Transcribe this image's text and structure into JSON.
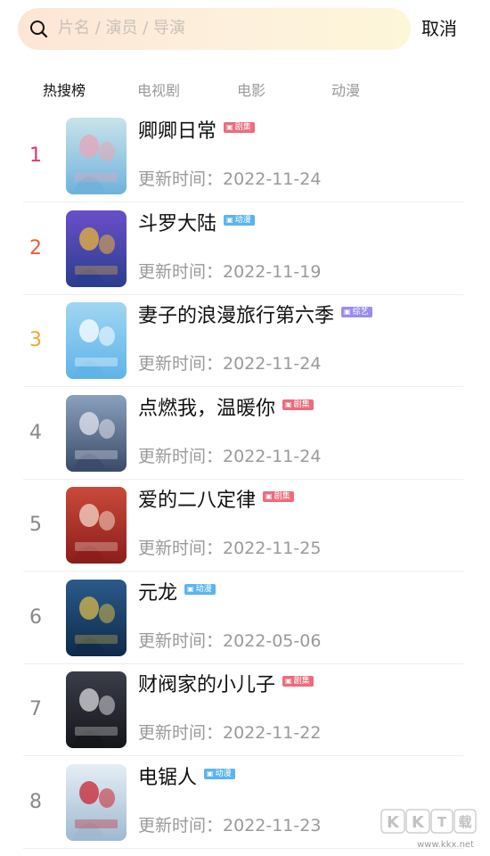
{
  "search": {
    "placeholder": "片名 / 演员 / 导演",
    "icon": "search-icon",
    "cancel_label": "取消"
  },
  "tabs": [
    {
      "label": "热搜榜",
      "active": true
    },
    {
      "label": "电视剧",
      "active": false
    },
    {
      "label": "电影",
      "active": false
    },
    {
      "label": "动漫",
      "active": false
    }
  ],
  "updated_prefix": "更新时间：",
  "badge_colors": {
    "剧集": "#ee6b7b",
    "动漫": "#5bb4ee",
    "综艺": "#9b8df0"
  },
  "rank_colors": {
    "1": "#e8336a",
    "2": "#ef5a3b",
    "3": "#f0a53a",
    "default": "#888888"
  },
  "items": [
    {
      "rank": "1",
      "title": "卿卿日常",
      "badge": "剧集",
      "updated": "更新时间：2022-11-24",
      "poster_colors": [
        "#6fb2dc",
        "#c9e3ea",
        "#e9a5b7"
      ]
    },
    {
      "rank": "2",
      "title": "斗罗大陆",
      "badge": "动漫",
      "updated": "更新时间：2022-11-19",
      "poster_colors": [
        "#2a3d8f",
        "#6a4fc8",
        "#e9b53a"
      ]
    },
    {
      "rank": "3",
      "title": "妻子的浪漫旅行第六季",
      "badge": "综艺",
      "updated": "更新时间：2022-11-24",
      "poster_colors": [
        "#5fb3e8",
        "#9fd6f2",
        "#ffffff"
      ]
    },
    {
      "rank": "4",
      "title": "点燃我，温暖你",
      "badge": "剧集",
      "updated": "更新时间：2022-11-24",
      "poster_colors": [
        "#3a4b6a",
        "#8aa0bd",
        "#e6e6ee"
      ]
    },
    {
      "rank": "5",
      "title": "爱的二八定律",
      "badge": "剧集",
      "updated": "更新时间：2022-11-25",
      "poster_colors": [
        "#8c1d1d",
        "#c94a3a",
        "#f4d8c8"
      ]
    },
    {
      "rank": "6",
      "title": "元龙",
      "badge": "动漫",
      "updated": "更新时间：2022-05-06",
      "poster_colors": [
        "#0f2a4a",
        "#2a5a8a",
        "#d8b84a"
      ]
    },
    {
      "rank": "7",
      "title": "财阀家的小儿子",
      "badge": "剧集",
      "updated": "更新时间：2022-11-22",
      "poster_colors": [
        "#15161c",
        "#3b3d48",
        "#d9d9de"
      ]
    },
    {
      "rank": "8",
      "title": "电锯人",
      "badge": "动漫",
      "updated": "更新时间：2022-11-23",
      "poster_colors": [
        "#9fb9cf",
        "#e5eef6",
        "#c8232f"
      ]
    }
  ],
  "watermark": {
    "brand": "KKT载",
    "url": "www.kkx.net"
  }
}
